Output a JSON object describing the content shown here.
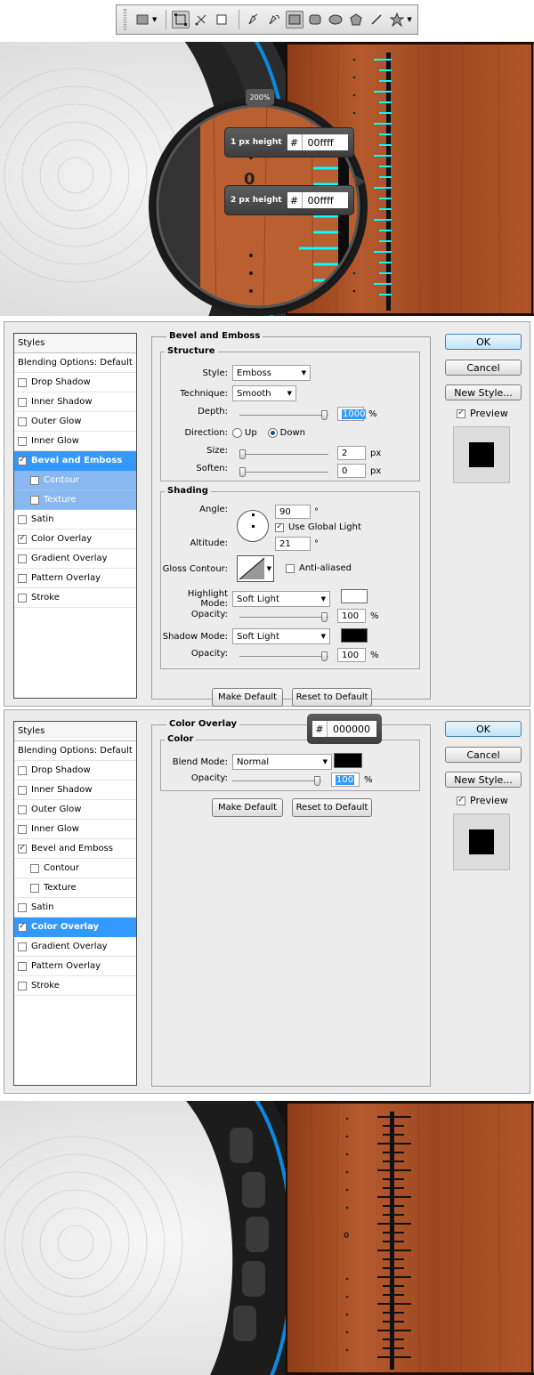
{
  "toolbar": {
    "tools": [
      "rect-marquee-icon",
      "shape-layers-icon",
      "paths-icon",
      "fill-pixels-icon",
      "pen-icon",
      "freeform-pen-icon",
      "rectangle-icon",
      "rounded-rectangle-icon",
      "ellipse-icon",
      "polygon-icon",
      "line-icon",
      "custom-shape-icon"
    ]
  },
  "art1": {
    "zoom": "200%",
    "callouts": [
      {
        "label": "1 px height",
        "hash": "#",
        "hex": "00ffff"
      },
      {
        "label": "2 px height",
        "hash": "#",
        "hex": "00ffff"
      }
    ],
    "colors": {
      "accent": "#00ffff",
      "wood": "#a0522d",
      "ring": "#0a8ae0"
    }
  },
  "dialog1": {
    "styles_header": "Styles",
    "styles": [
      {
        "label": "Blending Options: Default",
        "check": false,
        "checked": false,
        "state": "normal"
      },
      {
        "label": "Drop Shadow",
        "check": true,
        "checked": false,
        "state": "normal"
      },
      {
        "label": "Inner Shadow",
        "check": true,
        "checked": false,
        "state": "normal"
      },
      {
        "label": "Outer Glow",
        "check": true,
        "checked": false,
        "state": "normal"
      },
      {
        "label": "Inner Glow",
        "check": true,
        "checked": false,
        "state": "normal"
      },
      {
        "label": "Bevel and Emboss",
        "check": true,
        "checked": true,
        "state": "selected"
      },
      {
        "label": "Contour",
        "check": true,
        "checked": false,
        "state": "subsel",
        "sub": true
      },
      {
        "label": "Texture",
        "check": true,
        "checked": false,
        "state": "subsel",
        "sub": true
      },
      {
        "label": "Satin",
        "check": true,
        "checked": false,
        "state": "normal"
      },
      {
        "label": "Color Overlay",
        "check": true,
        "checked": true,
        "state": "normal"
      },
      {
        "label": "Gradient Overlay",
        "check": true,
        "checked": false,
        "state": "normal"
      },
      {
        "label": "Pattern Overlay",
        "check": true,
        "checked": false,
        "state": "normal"
      },
      {
        "label": "Stroke",
        "check": true,
        "checked": false,
        "state": "normal"
      }
    ],
    "panel_title": "Bevel and Emboss",
    "structure": {
      "title": "Structure",
      "style_label": "Style:",
      "style_value": "Emboss",
      "technique_label": "Technique:",
      "technique_value": "Smooth",
      "depth_label": "Depth:",
      "depth_value": "1000",
      "depth_unit": "%",
      "depth_level": 1.0,
      "direction_label": "Direction:",
      "dir_up": "Up",
      "dir_down": "Down",
      "size_label": "Size:",
      "size_value": "2",
      "size_unit": "px",
      "size_level": 0.0,
      "soften_label": "Soften:",
      "soften_value": "0",
      "soften_unit": "px",
      "soften_level": 0.0
    },
    "shading": {
      "title": "Shading",
      "angle_label": "Angle:",
      "angle_value": "90",
      "angle_unit": "°",
      "global_light": "Use Global Light",
      "altitude_label": "Altitude:",
      "altitude_value": "21",
      "altitude_unit": "°",
      "gloss_label": "Gloss Contour:",
      "anti_aliased": "Anti-aliased",
      "highlight_label": "Highlight Mode:",
      "highlight_value": "Soft Light",
      "highlight_color": "#ffffff",
      "opacity_label": "Opacity:",
      "highlight_opacity": "100",
      "opacity_unit": "%",
      "highlight_level": 1.0,
      "shadow_label": "Shadow Mode:",
      "shadow_value": "Soft Light",
      "shadow_color": "#000000",
      "shadow_opacity": "100",
      "shadow_level": 1.0
    },
    "make_default": "Make Default",
    "reset_default": "Reset to Default",
    "ok": "OK",
    "cancel": "Cancel",
    "new_style": "New Style...",
    "preview": "Preview"
  },
  "dialog2": {
    "styles_header": "Styles",
    "styles": [
      {
        "label": "Blending Options: Default",
        "check": false,
        "checked": false,
        "state": "normal"
      },
      {
        "label": "Drop Shadow",
        "check": true,
        "checked": false,
        "state": "normal"
      },
      {
        "label": "Inner Shadow",
        "check": true,
        "checked": false,
        "state": "normal"
      },
      {
        "label": "Outer Glow",
        "check": true,
        "checked": false,
        "state": "normal"
      },
      {
        "label": "Inner Glow",
        "check": true,
        "checked": false,
        "state": "normal"
      },
      {
        "label": "Bevel and Emboss",
        "check": true,
        "checked": true,
        "state": "normal"
      },
      {
        "label": "Contour",
        "check": true,
        "checked": false,
        "state": "normal",
        "sub": true
      },
      {
        "label": "Texture",
        "check": true,
        "checked": false,
        "state": "normal",
        "sub": true
      },
      {
        "label": "Satin",
        "check": true,
        "checked": false,
        "state": "normal"
      },
      {
        "label": "Color Overlay",
        "check": true,
        "checked": true,
        "state": "selected"
      },
      {
        "label": "Gradient Overlay",
        "check": true,
        "checked": false,
        "state": "normal"
      },
      {
        "label": "Pattern Overlay",
        "check": true,
        "checked": false,
        "state": "normal"
      },
      {
        "label": "Stroke",
        "check": true,
        "checked": false,
        "state": "normal"
      }
    ],
    "panel_title": "Color Overlay",
    "color": {
      "title": "Color",
      "blend_label": "Blend Mode:",
      "blend_value": "Normal",
      "blend_color": "#000000",
      "opacity_label": "Opacity:",
      "opacity_value": "100",
      "opacity_unit": "%",
      "opacity_level": 1.0
    },
    "hex_popup": {
      "hash": "#",
      "hex": "000000"
    },
    "make_default": "Make Default",
    "reset_default": "Reset to Default",
    "ok": "OK",
    "cancel": "Cancel",
    "new_style": "New Style...",
    "preview": "Preview"
  }
}
